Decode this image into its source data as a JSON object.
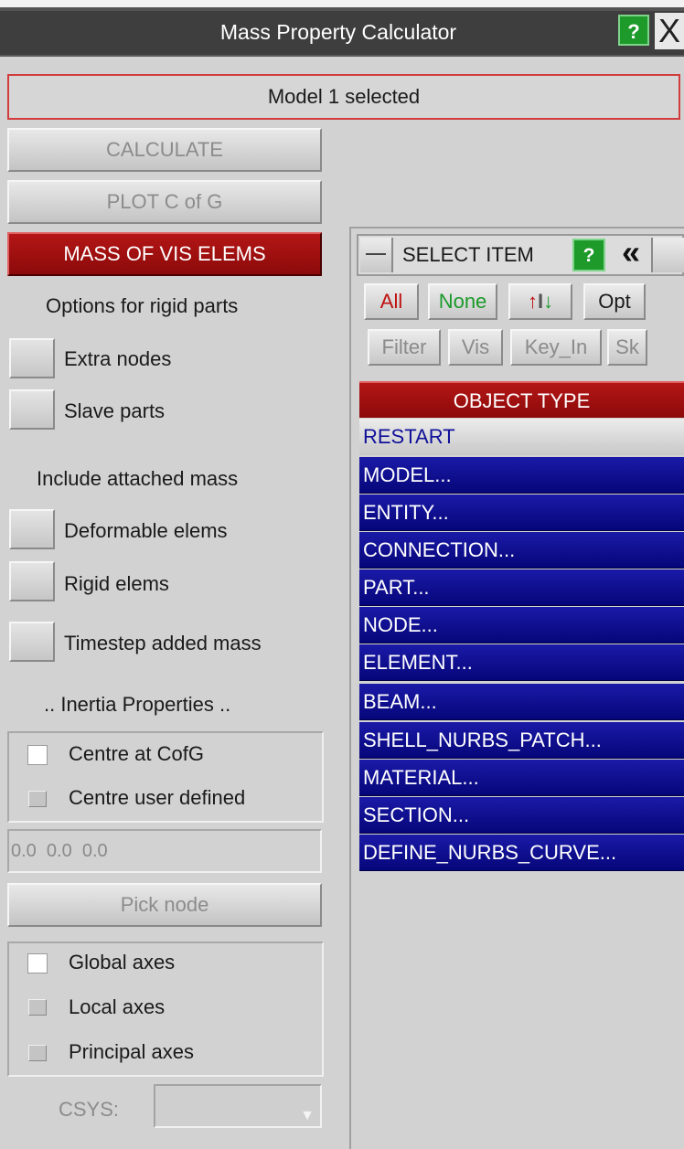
{
  "window": {
    "title": "Mass Property Calculator",
    "help_label": "?",
    "close_label": "X"
  },
  "status": "Model 1 selected",
  "buttons": {
    "calculate": "CALCULATE",
    "plot_cog": "PLOT C of G",
    "mass_vis": "MASS OF VIS ELEMS"
  },
  "rigid_parts": {
    "heading": "Options for rigid parts",
    "extra_nodes": "Extra nodes",
    "slave_parts": "Slave parts"
  },
  "attached_mass": {
    "heading": "Include attached mass",
    "deformable": "Deformable elems",
    "rigid": "Rigid elems",
    "timestep": "Timestep added mass"
  },
  "inertia": {
    "heading": ".. Inertia Properties ..",
    "centre_cog": "Centre at CofG",
    "centre_user": "Centre user defined",
    "coords": "0.0  0.0  0.0",
    "pick_node": "Pick node",
    "global_axes": "Global axes",
    "local_axes": "Local axes",
    "principal_axes": "Principal axes",
    "csys_label": "CSYS:"
  },
  "select": {
    "title": "SELECT ITEM",
    "help": "?",
    "collapse": "«",
    "all": "All",
    "none": "None",
    "opt": "Opt",
    "filter": "Filter",
    "vis": "Vis",
    "key_in": "Key_In",
    "sk": "Sk",
    "header": "OBJECT TYPE",
    "restart": "RESTART",
    "items": [
      "MODEL...",
      "ENTITY...",
      "CONNECTION...",
      "PART...",
      "NODE...",
      "ELEMENT...",
      "BEAM...",
      "SHELL_NURBS_PATCH...",
      "MATERIAL...",
      "SECTION...",
      "DEFINE_NURBS_CURVE..."
    ]
  },
  "colors": {
    "accent_red": "#a01010",
    "list_blue": "#10109a",
    "help_green": "#1e9a2a"
  }
}
